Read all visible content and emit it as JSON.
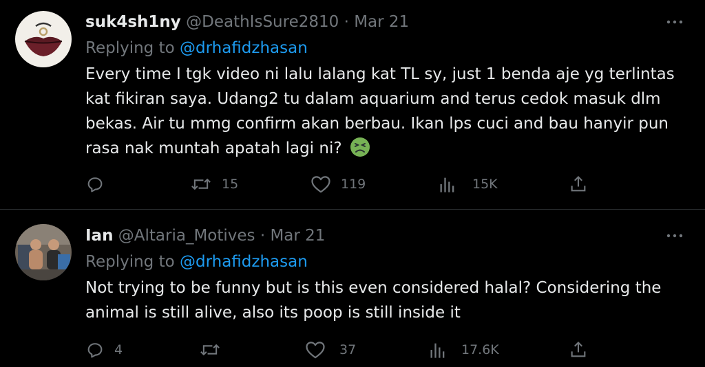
{
  "tweets": [
    {
      "display_name": "suk4sh1ny",
      "handle": "@DeathIsSure2810",
      "separator": "·",
      "date": "Mar 21",
      "replying_prefix": "Replying to",
      "replying_to": "@drhafidzhasan",
      "text": "Every time I tgk video ni lalu lalang kat TL sy, just 1 benda aje yg terlintas kat fikiran saya. Udang2 tu dalam aquarium and terus cedok masuk dlm bekas. Air tu mmg confirm akan berbau. Ikan lps cuci and bau hanyir pun rasa nak muntah apatah lagi ni?",
      "emoji": "nauseated-face",
      "actions": {
        "reply_count": "",
        "retweet_count": "15",
        "like_count": "119",
        "views_count": "15K"
      }
    },
    {
      "display_name": "Ian",
      "handle": "@Altaria_Motives",
      "separator": "·",
      "date": "Mar 21",
      "replying_prefix": "Replying to",
      "replying_to": "@drhafidzhasan",
      "text": "Not trying to be funny but is this even considered halal? Considering the animal is still alive, also its poop is still inside it",
      "actions": {
        "reply_count": "4",
        "retweet_count": "",
        "like_count": "37",
        "views_count": "17.6K"
      }
    }
  ],
  "colors": {
    "background": "#000000",
    "text_primary": "#e7e9ea",
    "text_secondary": "#71767b",
    "link": "#1d9bf0",
    "divider": "#2f3336"
  }
}
